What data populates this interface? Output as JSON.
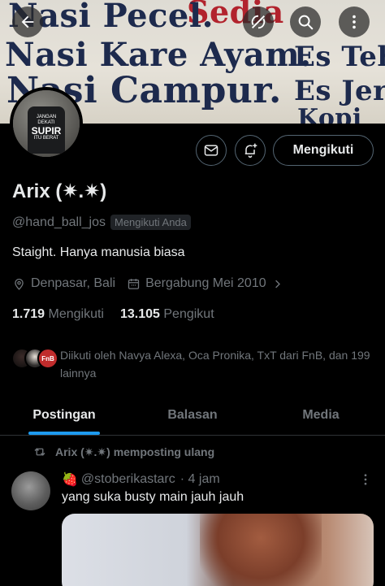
{
  "banner": {
    "line1": "Nasi Pecel.",
    "line2": "Nasi Kare Ayam.",
    "line3": "Nasi Campur.",
    "right1": "Es Teh",
    "right2": "Es Jeru",
    "right3": "Kopi",
    "red_text": "Sedia"
  },
  "avatar_shirt": {
    "top": "JANGAN DEKATI",
    "main": "SUPIR",
    "sub": "ITU BERAT"
  },
  "profile": {
    "name": "Arix (✷.✷)",
    "handle": "@hand_ball_jos",
    "follows_you": "Mengikuti Anda",
    "bio": "Staight. Hanya manusia biasa",
    "location": "Denpasar, Bali",
    "joined": "Bergabung Mei 2010",
    "following_count": "1.719",
    "following_label": "Mengikuti",
    "followers_count": "13.105",
    "followers_label": "Pengikut",
    "followed_by": "Diikuti oleh Navya Alexa, Oca Pronika, TxT dari FnB, dan 199 lainnya",
    "mini3_text": "FnB"
  },
  "actions": {
    "follow_label": "Mengikuti"
  },
  "tabs": [
    {
      "label": "Postingan",
      "active": true
    },
    {
      "label": "Balasan",
      "active": false
    },
    {
      "label": "Media",
      "active": false
    }
  ],
  "tweet": {
    "repost_text": "Arix (✷.✷) memposting ulang",
    "emoji": "🍓",
    "author_handle": "@stoberikastarc",
    "time": "· 4 jam",
    "text": "yang suka busty main jauh jauh"
  },
  "colors": {
    "accent": "#1d9bf0",
    "muted": "#71767b",
    "text": "#e7e9ea",
    "border": "#2f3336"
  }
}
